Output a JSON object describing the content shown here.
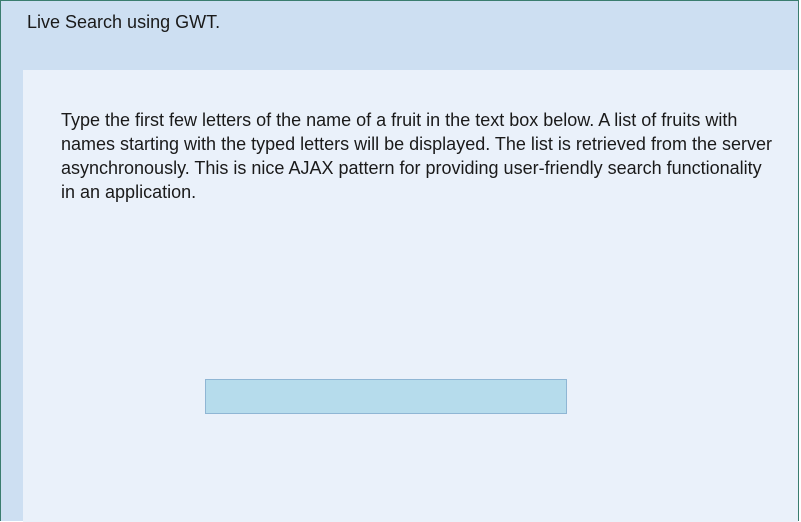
{
  "window": {
    "title": "Live Search using GWT."
  },
  "content": {
    "description": "Type the first few letters of the name of a fruit in the text box below. A list of fruits with names starting with the typed letters will be displayed. The list is retrieved from the server asynchronously. This is nice AJAX pattern for providing user-friendly search functionality in an application."
  },
  "search": {
    "value": "",
    "placeholder": ""
  }
}
